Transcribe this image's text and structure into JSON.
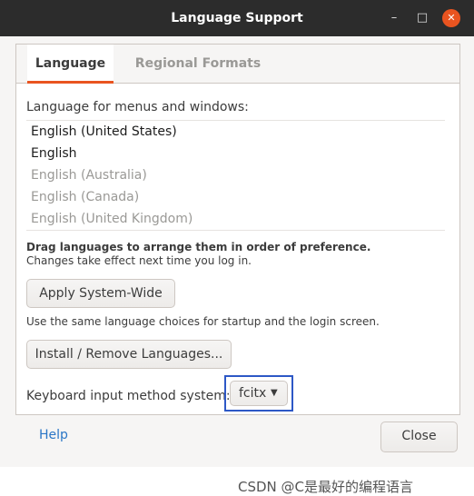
{
  "window": {
    "title": "Language Support",
    "controls": {
      "minimize": "–",
      "maximize": "□",
      "close": "✕"
    }
  },
  "tabs": [
    {
      "label": "Language",
      "active": true
    },
    {
      "label": "Regional Formats",
      "active": false
    }
  ],
  "language_tab": {
    "menus_label": "Language for menus and windows:",
    "languages": [
      {
        "label": "English (United States)",
        "enabled": true
      },
      {
        "label": "English",
        "enabled": true
      },
      {
        "label": "English (Australia)",
        "enabled": false
      },
      {
        "label": "English (Canada)",
        "enabled": false
      },
      {
        "label": "English (United Kingdom)",
        "enabled": false
      }
    ],
    "drag_hint_bold": "Drag languages to arrange them in order of preference.",
    "drag_hint": "Changes take effect next time you log in.",
    "apply_button": "Apply System-Wide",
    "apply_hint": "Use the same language choices for startup and the login screen.",
    "install_button": "Install / Remove Languages...",
    "input_method_label": "Keyboard input method system:",
    "input_method_value": "fcitx"
  },
  "footer": {
    "help_label": "Help",
    "close_label": "Close"
  },
  "watermark": "CSDN @C是最好的编程语言",
  "colors": {
    "accent": "#e95420",
    "highlight_frame": "#2d58c6",
    "link": "#2a76c6"
  },
  "icons": {
    "combo_arrow": "dropdown-arrow-icon"
  }
}
